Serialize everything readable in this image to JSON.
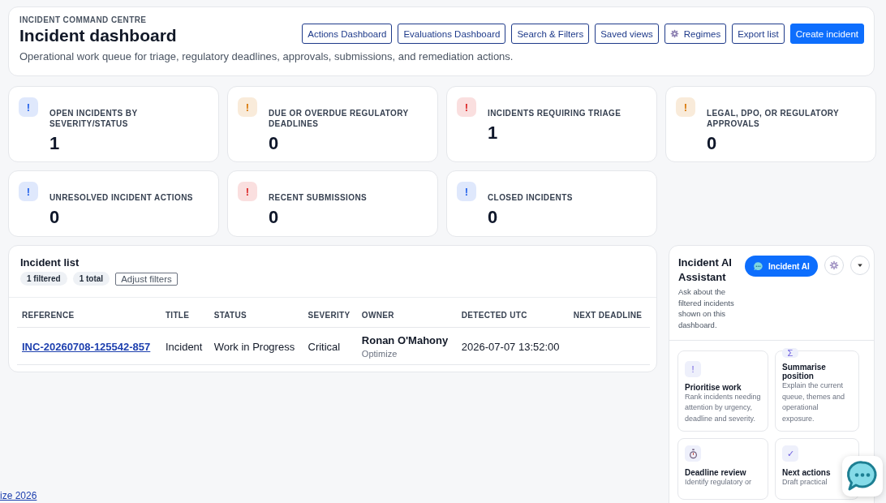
{
  "header": {
    "eyebrow": "INCIDENT COMMAND CENTRE",
    "title": "Incident dashboard",
    "subtitle": "Operational work queue for triage, regulatory deadlines, approvals, submissions, and remediation actions.",
    "buttons": [
      {
        "label": "Actions Dashboard",
        "kind": "outline"
      },
      {
        "label": "Evaluations Dashboard",
        "kind": "outline"
      },
      {
        "label": "Search & Filters",
        "kind": "outline"
      },
      {
        "label": "Saved views",
        "kind": "outline"
      },
      {
        "label": "Regimes",
        "kind": "gear"
      },
      {
        "label": "Export list",
        "kind": "outline"
      },
      {
        "label": "Create incident",
        "kind": "primary"
      }
    ]
  },
  "stats": [
    {
      "glyph": "!",
      "label": "OPEN INCIDENTS BY SEVERITY/STATUS",
      "value": "1",
      "color": "#2563eb"
    },
    {
      "glyph": "!",
      "label": "DUE OR OVERDUE REGULATORY DEADLINES",
      "value": "0",
      "color": "#d97706"
    },
    {
      "glyph": "!",
      "label": "INCIDENTS REQUIRING TRIAGE",
      "value": "1",
      "color": "#dc2626"
    },
    {
      "glyph": "!",
      "label": "LEGAL, DPO, OR REGULATORY APPROVALS",
      "value": "0",
      "color": "#d97706"
    },
    {
      "glyph": "!",
      "label": "UNRESOLVED INCIDENT ACTIONS",
      "value": "0",
      "color": "#2563eb"
    },
    {
      "glyph": "!",
      "label": "RECENT SUBMISSIONS",
      "value": "0",
      "color": "#dc2626"
    },
    {
      "glyph": "!",
      "label": "CLOSED INCIDENTS",
      "value": "0",
      "color": "#2563eb"
    }
  ],
  "incident_list": {
    "title": "Incident list",
    "pills": [
      "1 filtered",
      "1 total"
    ],
    "adjust_button": "Adjust filters",
    "columns": [
      "REFERENCE",
      "TITLE",
      "STATUS",
      "SEVERITY",
      "OWNER",
      "DETECTED UTC",
      "NEXT DEADLINE"
    ],
    "rows": [
      {
        "reference": "INC-20260708-125542-857",
        "title": "Incident",
        "status": "Work in Progress",
        "severity": "Critical",
        "owner": "Ronan O'Mahony",
        "owner_org": "Optimize",
        "detected": "2026-07-07 13:52:00"
      }
    ]
  },
  "assistant": {
    "title": "Incident AI Assistant",
    "description": "Ask about the filtered incidents shown on this dashboard.",
    "ai_button": "Incident AI",
    "prompts": [
      {
        "kind": "glyph",
        "glyph": "!",
        "title": "Prioritise work",
        "description": "Rank incidents needing attention by urgency, deadline and severity."
      },
      {
        "kind": "glyph",
        "glyph": "Σ",
        "title": "Summarise position",
        "description": "Explain the current queue, themes and operational exposure."
      },
      {
        "kind": "stopwatch",
        "title": "Deadline review",
        "description": "Identify regulatory or"
      },
      {
        "kind": "glyph",
        "glyph": "✓",
        "title": "Next actions",
        "description": "Draft practical"
      }
    ]
  },
  "footer_link": "ize 2026"
}
